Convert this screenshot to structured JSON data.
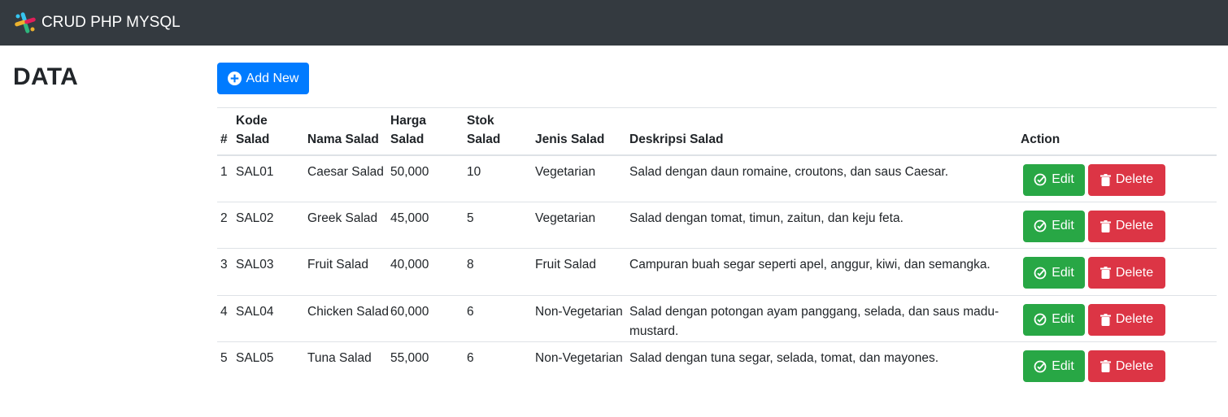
{
  "navbar": {
    "brand": "CRUD PHP MYSQL",
    "logo_icon": "slack-logo-icon"
  },
  "page": {
    "title": "DATA"
  },
  "toolbar": {
    "add_label": "Add New",
    "add_icon": "plus-circle-icon"
  },
  "table": {
    "headers": {
      "no": "#",
      "kode_1": "Kode",
      "kode_2": "Salad",
      "nama": "Nama Salad",
      "harga_1": "Harga",
      "harga_2": "Salad",
      "stok_1": "Stok",
      "stok_2": "Salad",
      "jenis": "Jenis Salad",
      "deskripsi": "Deskripsi Salad",
      "action": "Action"
    },
    "rows": [
      {
        "no": "1",
        "kode": "SAL01",
        "nama": "Caesar Salad",
        "harga": "50,000",
        "stok": "10",
        "jenis": "Vegetarian",
        "deskripsi": "Salad dengan daun romaine, croutons, dan saus Caesar."
      },
      {
        "no": "2",
        "kode": "SAL02",
        "nama": "Greek Salad",
        "harga": "45,000",
        "stok": "5",
        "jenis": "Vegetarian",
        "deskripsi": "Salad dengan tomat, timun, zaitun, dan keju feta."
      },
      {
        "no": "3",
        "kode": "SAL03",
        "nama": "Fruit Salad",
        "harga": "40,000",
        "stok": "8",
        "jenis": "Fruit Salad",
        "deskripsi": "Campuran buah segar seperti apel, anggur, kiwi, dan semangka."
      },
      {
        "no": "4",
        "kode": "SAL04",
        "nama": "Chicken Salad",
        "harga": "60,000",
        "stok": "6",
        "jenis": "Non-Vegetarian",
        "deskripsi": "Salad dengan potongan ayam panggang, selada, dan saus madu-mustard."
      },
      {
        "no": "5",
        "kode": "SAL05",
        "nama": "Tuna Salad",
        "harga": "55,000",
        "stok": "6",
        "jenis": "Non-Vegetarian",
        "deskripsi": "Salad dengan tuna segar, selada, tomat, dan mayones."
      }
    ],
    "edit_label": "Edit",
    "delete_label": "Delete"
  },
  "colors": {
    "navbar": "#343a40",
    "primary": "#007bff",
    "success": "#28a745",
    "danger": "#dc3545"
  }
}
